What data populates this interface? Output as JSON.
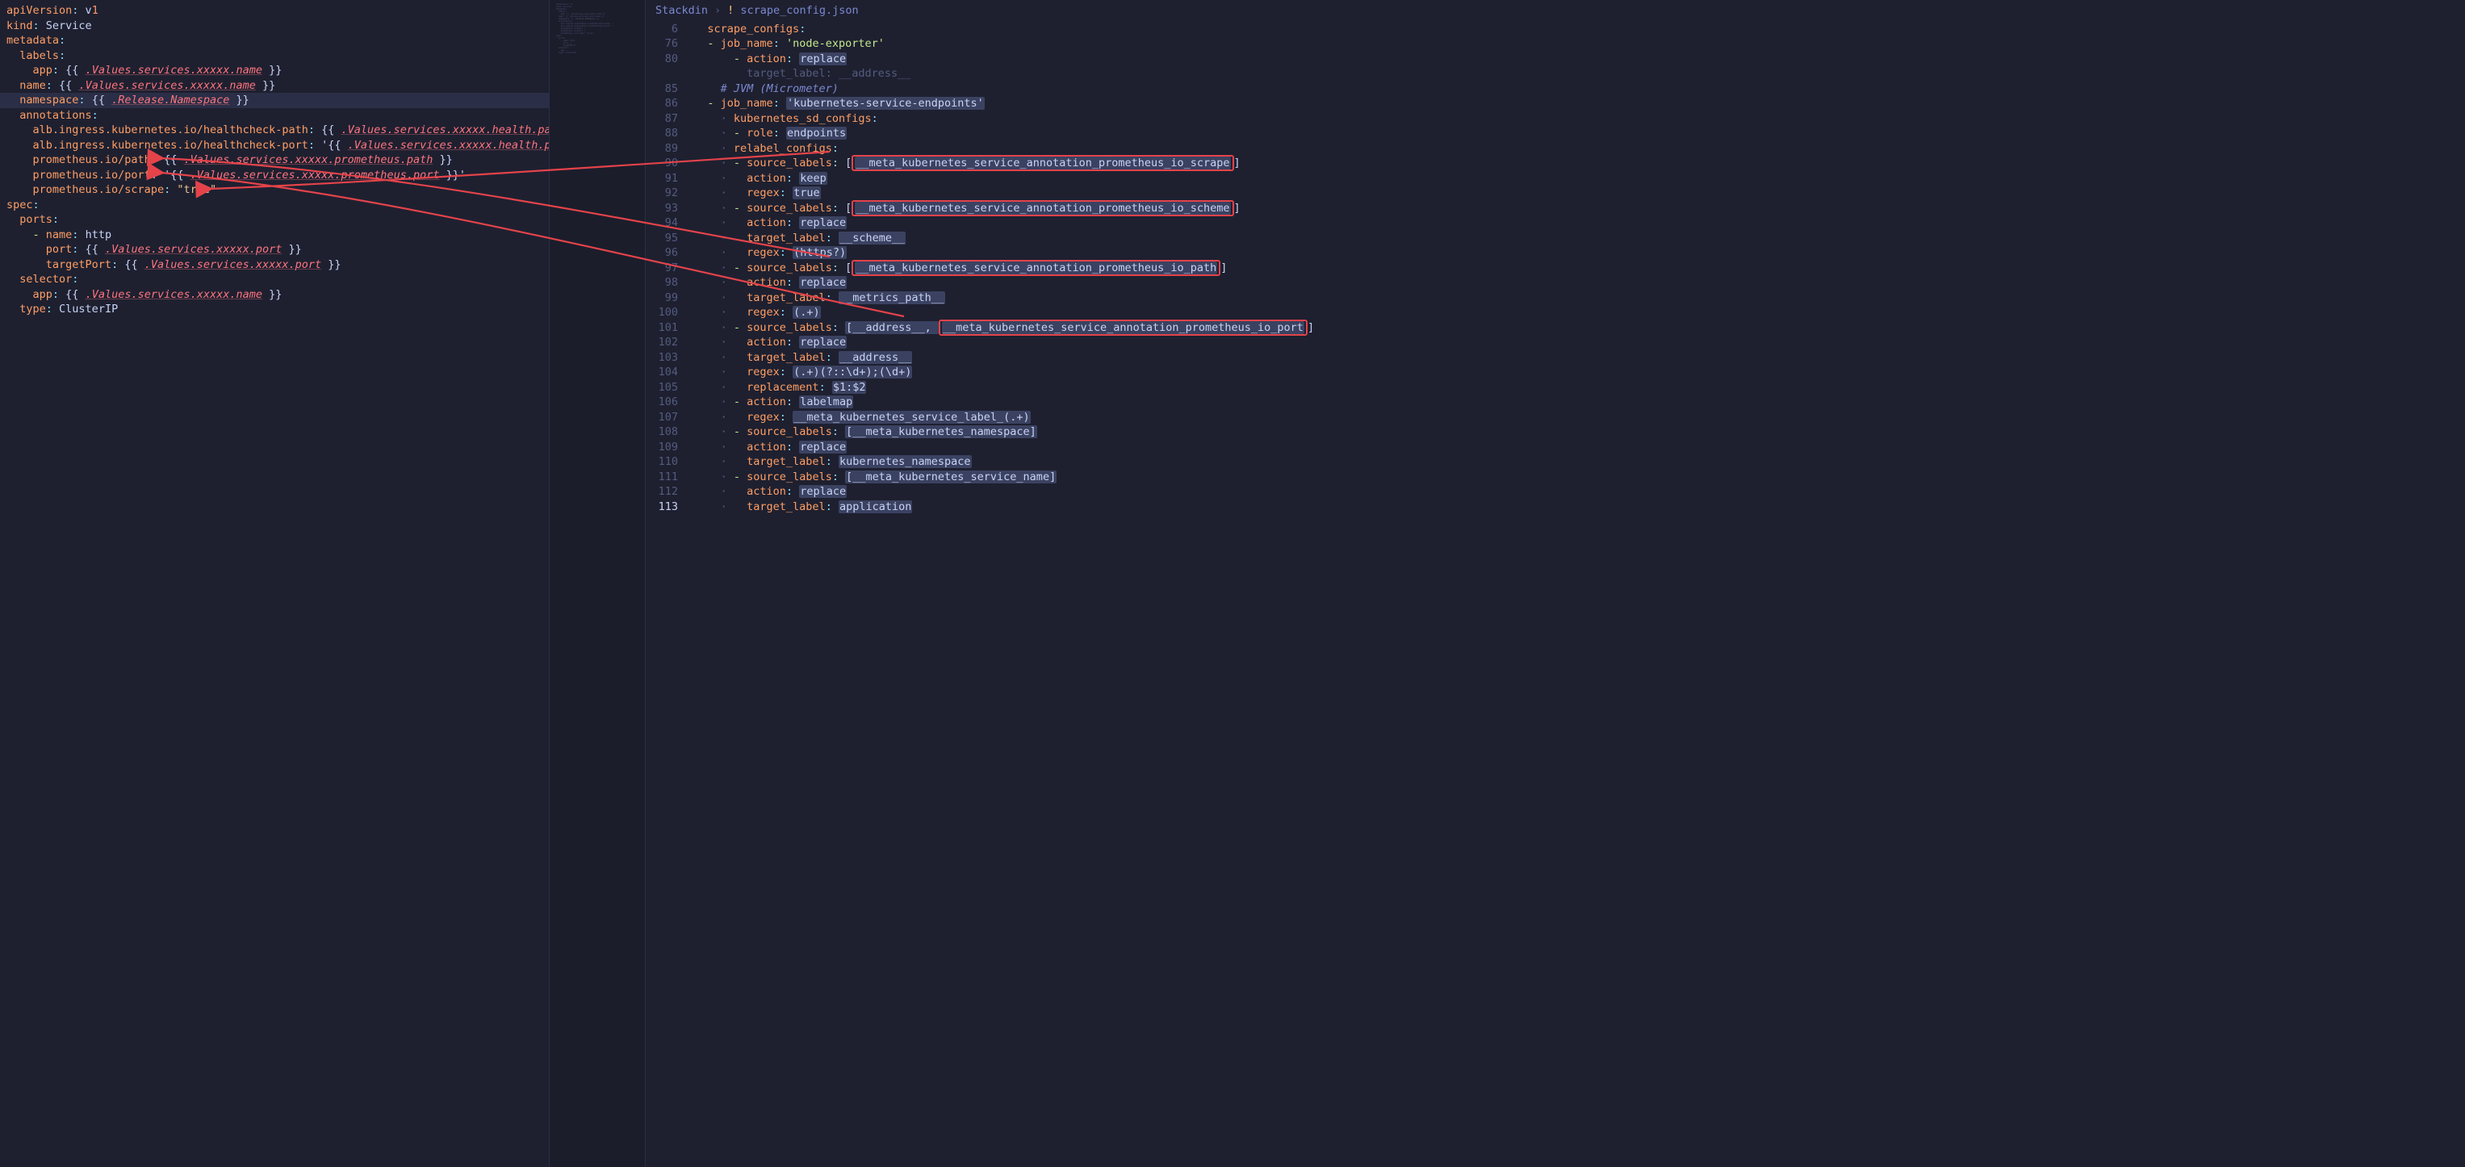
{
  "breadcrumb": {
    "root": "Stackdin",
    "file": "scrape_config.json",
    "sep": "›"
  },
  "left": {
    "l1a": "apiVersion",
    "l1b": "v",
    "l1c": "1",
    "l2a": "kind",
    "l2b": "Service",
    "l3": "metadata",
    "l4": "labels",
    "l5a": "app",
    "l5b": "{{ ",
    "l5c": ".Values.services.xxxxx.name",
    "l5d": " }}",
    "l6a": "name",
    "l6b": "{{ ",
    "l6c": ".Values.services.xxxxx.name",
    "l6d": " }}",
    "l7a": "namespace",
    "l7b": "{{ ",
    "l7c": ".Release.Namespace",
    "l7d": " }}",
    "l8": "annotations",
    "l9a": "alb.ingress.kubernetes.io/healthcheck-path",
    "l9b": "{{ ",
    "l9c": ".Values.services.xxxxx.health.path",
    "l9d": " }}",
    "l10a": "alb.ingress.kubernetes.io/healthcheck-port",
    "l10b": "'{{ ",
    "l10c": ".Values.services.xxxxx.health.port",
    "l10d": " }}'",
    "l11a": "prometheus.io/path",
    "l11b": "{{ ",
    "l11c": ".Values.services.xxxxx.prometheus.path",
    "l11d": " }}",
    "l12a": "prometheus.io/port",
    "l12b": "'{{ ",
    "l12c": ".Values.services.xxxxx.prometheus.port",
    "l12d": " }}'",
    "l13a": "prometheus.io/scrape",
    "l13b": "\"true\"",
    "l14": "spec",
    "l15": "ports",
    "l16a": "- ",
    "l16b": "name",
    "l16c": "http",
    "l17a": "port",
    "l17b": "{{ ",
    "l17c": ".Values.services.xxxxx.port",
    "l17d": " }}",
    "l18a": "targetPort",
    "l18b": "{{ ",
    "l18c": ".Values.services.xxxxx.port",
    "l18d": " }}",
    "l19": "selector",
    "l20a": "app",
    "l20b": "{{ ",
    "l20c": ".Values.services.xxxxx.name",
    "l20d": " }}",
    "l21a": "type",
    "l21b": "ClusterIP"
  },
  "rg": {
    "6": "6",
    "76": "76",
    "80": "80",
    "85": "85",
    "86": "86",
    "87": "87",
    "88": "88",
    "89": "89",
    "90": "90",
    "91": "91",
    "92": "92",
    "93": "93",
    "94": "94",
    "95": "95",
    "96": "96",
    "97": "97",
    "98": "98",
    "99": "99",
    "100": "100",
    "101": "101",
    "102": "102",
    "103": "103",
    "104": "104",
    "105": "105",
    "106": "106",
    "107": "107",
    "108": "108",
    "109": "109",
    "110": "110",
    "111": "111",
    "112": "112",
    "113": "113"
  },
  "r": {
    "scrape_configs": "scrape_configs",
    "job_name": "job_name",
    "node_exporter": "'node-exporter'",
    "action": "action",
    "replace": "replace",
    "keep": "keep",
    "labelmap": "labelmap",
    "target_label": "target_label",
    "address": "__address__",
    "jvm": "# JVM (Micrometer)",
    "kse": "'kubernetes-service-endpoints'",
    "ksd": "kubernetes_sd_configs",
    "role": "role",
    "endpoints": "endpoints",
    "relabel_configs": "relabel_configs",
    "source_labels": "source_labels",
    "lb_scrape": "__meta_kubernetes_service_annotation_prometheus_io_scrape",
    "lb_scheme": "__meta_kubernetes_service_annotation_prometheus_io_scheme",
    "lb_path": "__meta_kubernetes_service_annotation_prometheus_io_path",
    "lb_port": "__meta_kubernetes_service_annotation_prometheus_io_port",
    "regex": "regex",
    "rtrue": "true",
    "rhttps": "(https?)",
    "rplus": "(.+)",
    "scheme": "__scheme__",
    "metrics_path": "__metrics_path__",
    "addr_combo_a": "[__address__, ",
    "rport": "(.+)(?::\\d+);(\\d+)",
    "replacement": "replacement",
    "r12": "$1:$2",
    "rlabel": "__meta_kubernetes_service_label_(.+)",
    "ns": "[__meta_kubernetes_namespace]",
    "kns": "kubernetes_namespace",
    "svc": "[__meta_kubernetes_service_name]",
    "app": "application",
    "br_o": "[",
    "br_c": "]"
  },
  "mini": "apiVersion: v1\nkind: Service\nmetadata:\n  labels:\n    app: {{ .Values.services.xxxxx.name }}\n  name: {{ .Values.services.xxxxx.name }}\n  namespace: {{ .Release.Namespace }}\n  annotations:\n    alb.ingress.kubernetes.io/healthcheck-path: …\n    alb.ingress.kubernetes.io/healthcheck-port: …\n    prometheus.io/path: …\n    prometheus.io/port: …\n    prometheus.io/scrape: \"true\"\nspec:\n  ports:\n    - name: http\n      port: …\n      targetPort: …\n  selector:\n    app: …\n  type: ClusterIP"
}
